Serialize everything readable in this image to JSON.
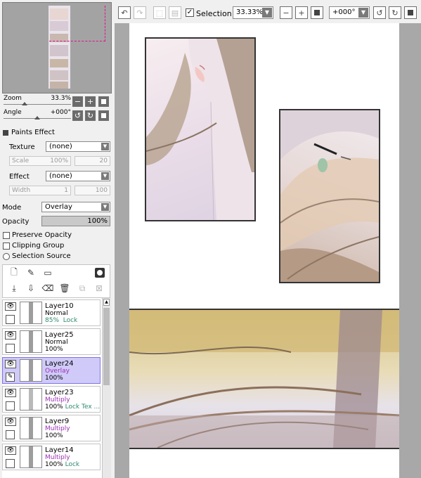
{
  "navigator": {
    "zoom_label": "Zoom",
    "zoom_value": "33.3%",
    "angle_label": "Angle",
    "angle_value": "+000°"
  },
  "paints_effect": {
    "title": "Paints Effect",
    "texture_label": "Texture",
    "texture_value": "(none)",
    "scale_label": "Scale",
    "scale_value": "100%",
    "scale_number": "20",
    "effect_label": "Effect",
    "effect_value": "(none)",
    "width_label": "Width",
    "width_value": "1",
    "width_number": "100"
  },
  "blend": {
    "mode_label": "Mode",
    "mode_value": "Overlay",
    "opacity_label": "Opacity",
    "opacity_value": "100%",
    "opacity_fraction": 1.0
  },
  "options": {
    "preserve_opacity": "Preserve Opacity",
    "clipping_group": "Clipping Group",
    "selection_source": "Selection Source"
  },
  "layers": [
    {
      "name": "Layer10",
      "mode": "Normal",
      "opacity": "85%",
      "lock": "Lock",
      "extra": ""
    },
    {
      "name": "Layer25",
      "mode": "Normal",
      "opacity": "100%",
      "lock": "",
      "extra": ""
    },
    {
      "name": "Layer24",
      "mode": "Overlay",
      "opacity": "100%",
      "lock": "",
      "extra": ""
    },
    {
      "name": "Layer23",
      "mode": "Multiply",
      "opacity": "100%",
      "lock": "Lock",
      "extra": "Tex ..."
    },
    {
      "name": "Layer9",
      "mode": "Multiply",
      "opacity": "100%",
      "lock": "",
      "extra": ""
    },
    {
      "name": "Layer14",
      "mode": "Multiply",
      "opacity": "100%",
      "lock": "Lock",
      "extra": ""
    }
  ],
  "toolbar": {
    "selection_label": "Selection",
    "selection_checked": true,
    "zoom_value": "33.33%",
    "angle_value": "+000°"
  },
  "colors": {
    "selected_layer": "#cfcaf8",
    "mode_purple": "#9b2fb5",
    "lock_green": "#2e8a6f",
    "navigator_frame": "#e0108a"
  }
}
